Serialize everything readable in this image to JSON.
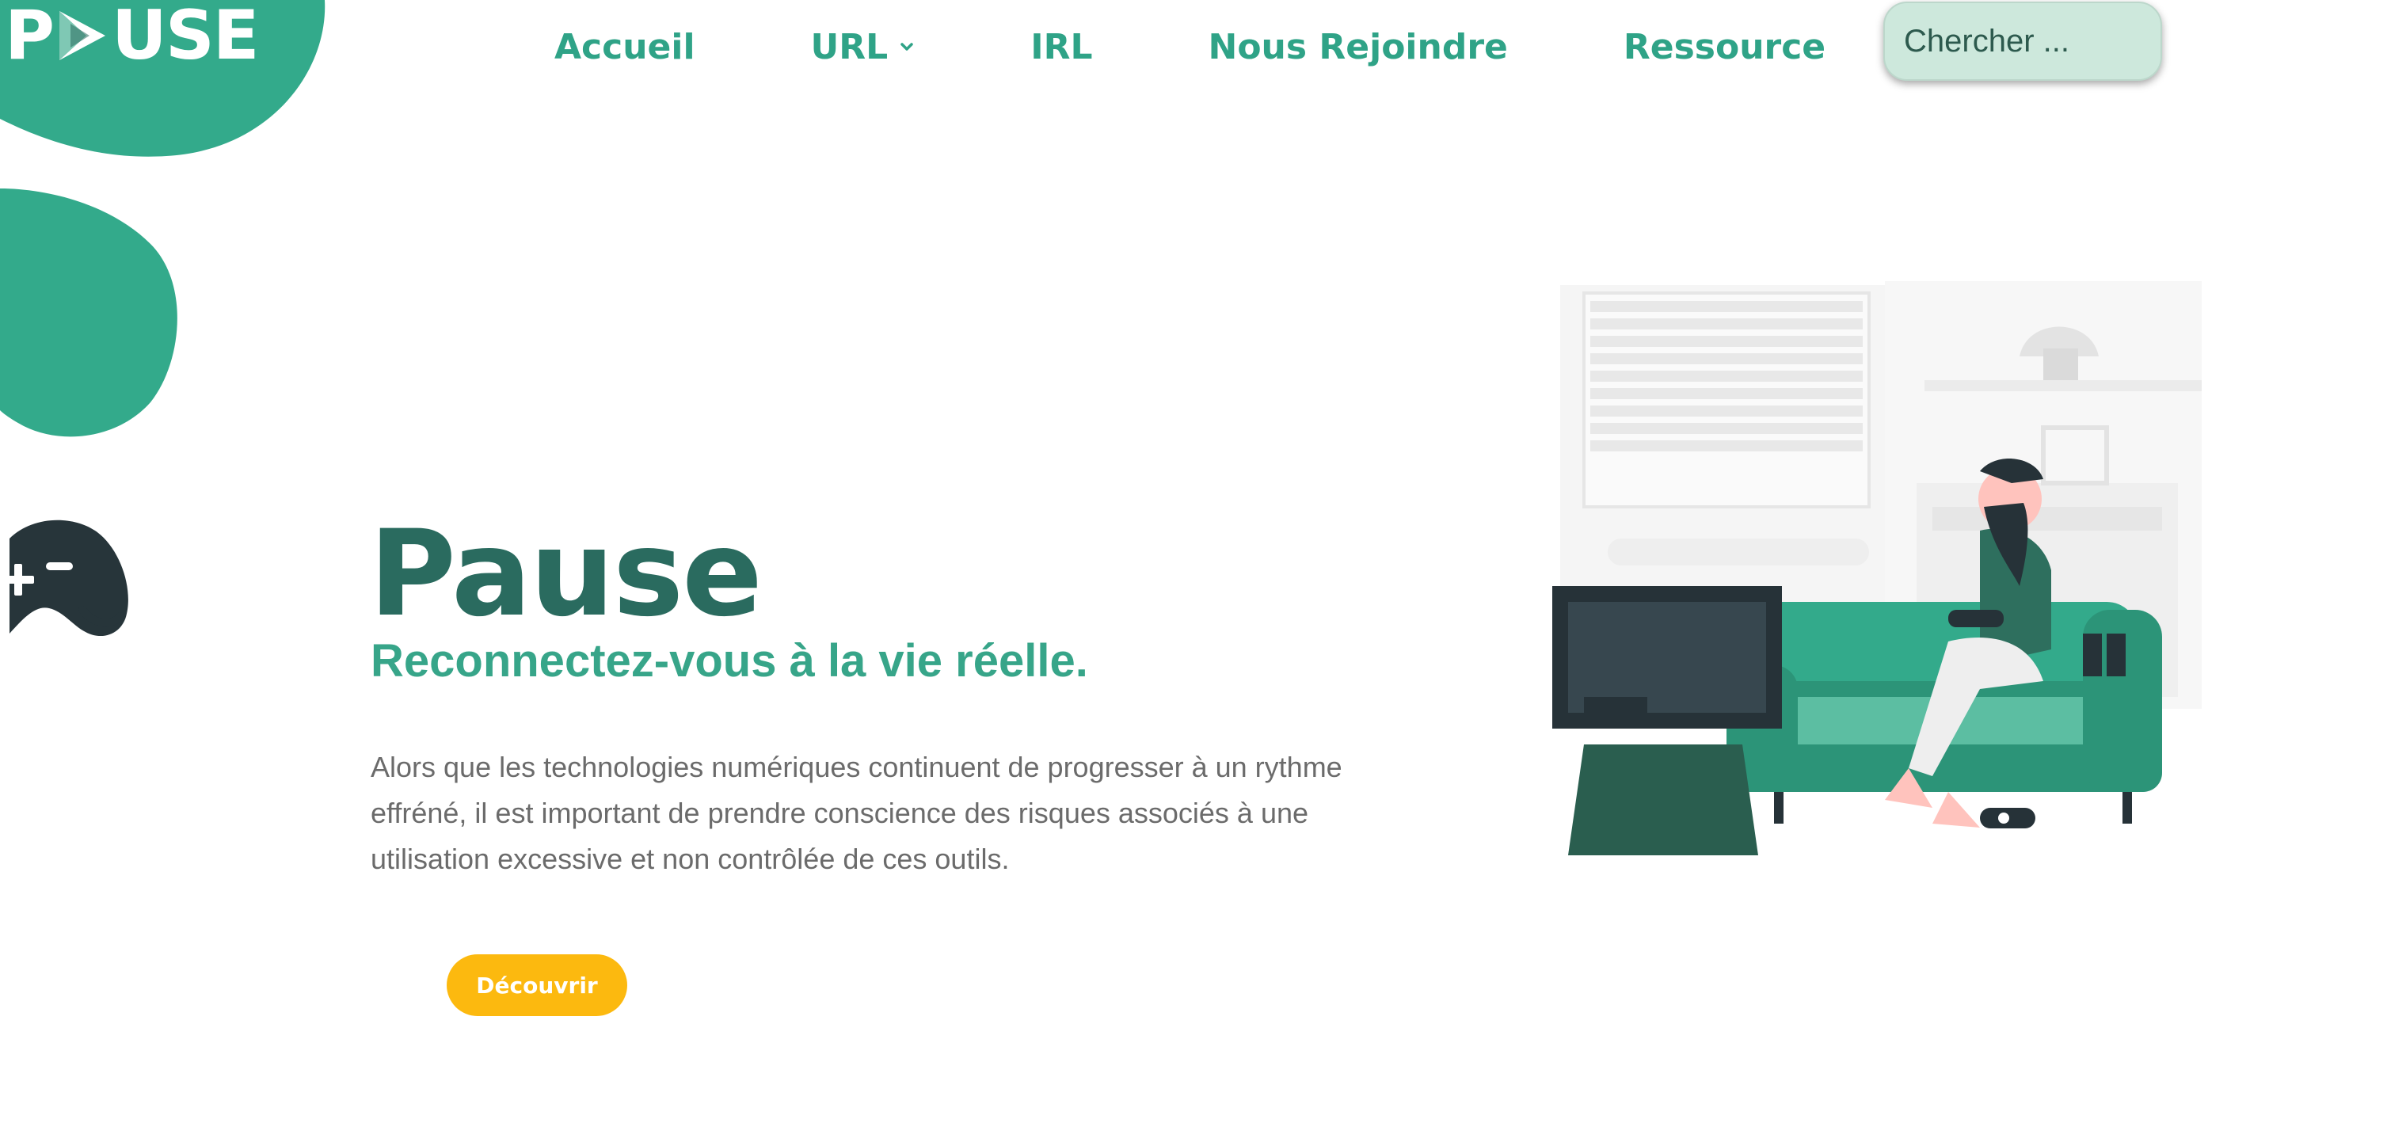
{
  "brand": {
    "logo_left": "P",
    "logo_right": "USE"
  },
  "nav": {
    "items": [
      {
        "label": "Accueil"
      },
      {
        "label": "URL"
      },
      {
        "label": "IRL"
      },
      {
        "label": "Nous Rejoindre"
      },
      {
        "label": "Ressource"
      }
    ]
  },
  "search": {
    "placeholder": "Chercher ..."
  },
  "hero": {
    "title": "Pause",
    "subtitle": "Reconnectez-vous à la vie réelle.",
    "body": "Alors que les technologies numériques continuent de progresser à un rythme effréné, il est important de prendre conscience des risques associés à une utilisation excessive et non contrôlée de ces outils.",
    "cta_label": "Découvrir"
  },
  "icons": {
    "logo_play": "play-triangle-icon",
    "nav_chevron": "chevron-down-icon",
    "gamepad": "gamepad-icon"
  },
  "colors": {
    "brand_green": "#2fa387",
    "title_dark_green": "#2a6b5f",
    "subtitle_green": "#37a589",
    "body_gray": "#6b6b6b",
    "cta_yellow": "#fcb90f",
    "search_bg": "#cde8dc"
  }
}
